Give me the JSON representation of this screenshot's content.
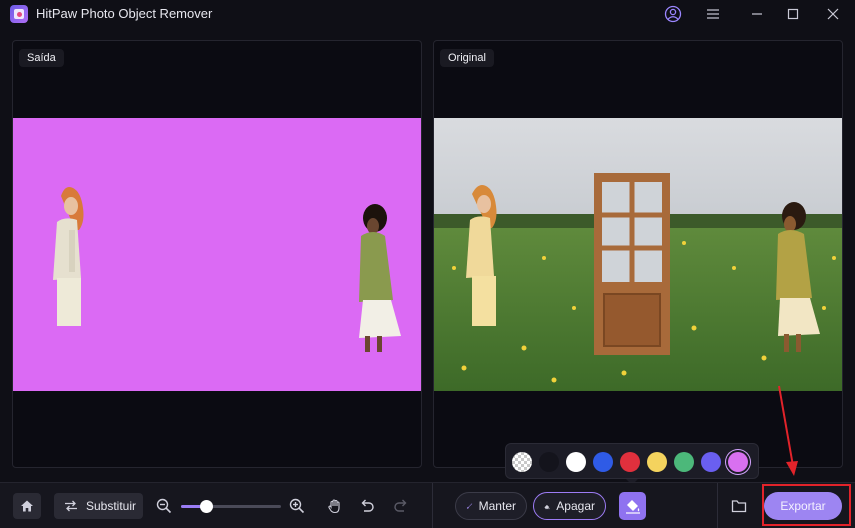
{
  "window": {
    "title": "HitPaw Photo Object Remover",
    "icons": [
      "app-logo-icon",
      "account-icon",
      "menu-icon",
      "minimize-icon",
      "maximize-icon",
      "close-icon"
    ]
  },
  "panels": {
    "left": {
      "label": "Saída",
      "background_color": "#db6af4",
      "people": [
        "woman-cream-outfit",
        "woman-green-sweater-white-skirt"
      ]
    },
    "right": {
      "label": "Original",
      "scene": "field-with-yellow-flowers-wooden-door-two-women"
    }
  },
  "palette": {
    "colors": [
      "transparent",
      "#14141c",
      "#ffffff",
      "#2f5be6",
      "#e0303d",
      "#f4d35e",
      "#4cb87a",
      "#6a5ff0",
      "#d870f0"
    ],
    "selected_index": 8
  },
  "toolbar": {
    "home_icon": "home-icon",
    "substituir_label": "Substituir",
    "zoom_level": 0.25,
    "manter_label": "Manter",
    "apagar_label": "Apagar",
    "fill_icon": "paint-bucket-icon",
    "folder_icon": "folder-icon",
    "export_label": "Exportar"
  },
  "colors": {
    "accent": "#9d85f2",
    "highlight": "#e2232a"
  }
}
